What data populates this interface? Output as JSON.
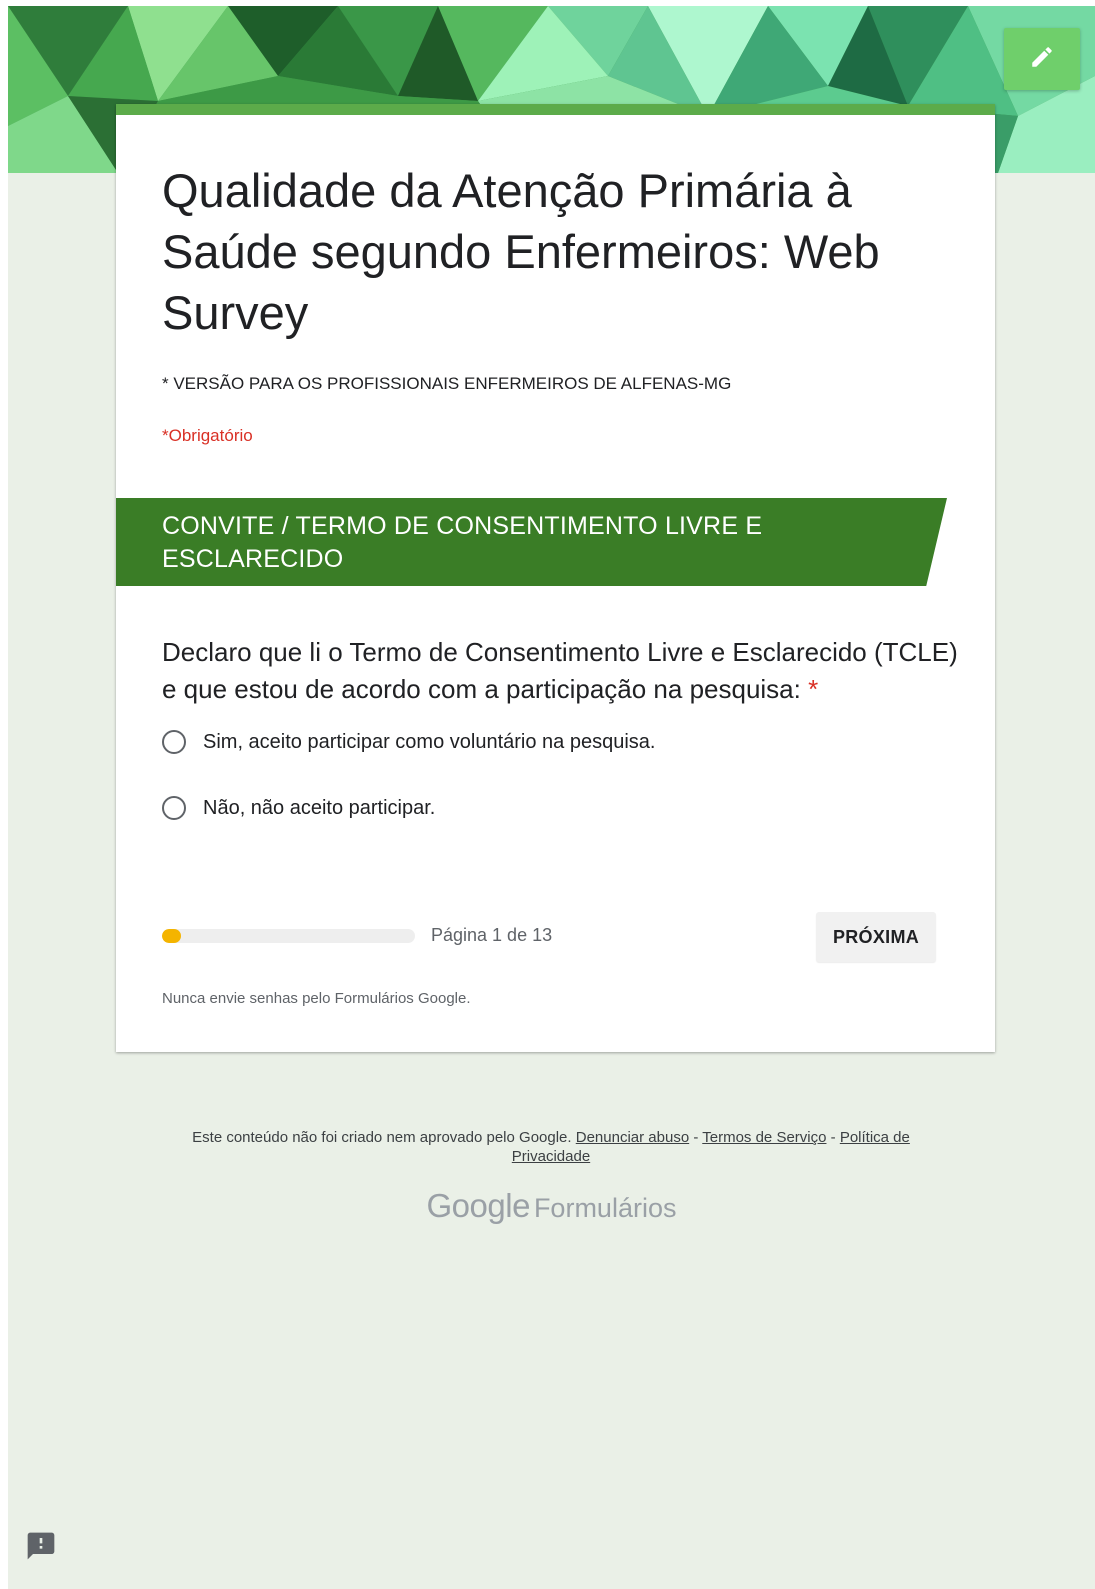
{
  "form": {
    "title": "Qualidade da Atenção Primária à Saúde segundo Enfermeiros: Web Survey",
    "description": "* VERSÃO PARA OS PROFISSIONAIS ENFERMEIROS DE ALFENAS-MG",
    "required_note": "*Obrigatório"
  },
  "section": {
    "title": "CONVITE / TERMO DE CONSENTIMENTO LIVRE E ESCLARECIDO"
  },
  "question": {
    "text": "Declaro que li o Termo de Consentimento Livre e Esclarecido (TCLE) e que estou de acordo com a participação na pesquisa: ",
    "required_marker": "*",
    "options": [
      {
        "label": "Sim, aceito participar como voluntário na pesquisa.",
        "selected": false
      },
      {
        "label": "Não, não aceito participar.",
        "selected": false
      }
    ]
  },
  "progress": {
    "text": "Página 1 de 13",
    "current_page": 1,
    "total_pages": 13
  },
  "navigation": {
    "next_label": "PRÓXIMA"
  },
  "warning": {
    "text": "Nunca envie senhas pelo Formulários Google."
  },
  "footer": {
    "disclaimer": "Este conteúdo não foi criado nem aprovado pelo Google.",
    "report_abuse": "Denunciar abuso",
    "separator": "-",
    "terms": "Termos de Serviço",
    "privacy": "Política de Privacidade",
    "brand_google": "Google",
    "brand_forms": "Formulários"
  },
  "icons": {
    "edit": "pencil-icon",
    "feedback": "feedback-icon"
  },
  "colors": {
    "section_header": "#3a7d26",
    "accent_bar": "#5cab4a",
    "edit_button": "#6fcf6b",
    "progress_fill": "#f4b400",
    "required": "#d93025",
    "background": "#eaf0e7"
  }
}
